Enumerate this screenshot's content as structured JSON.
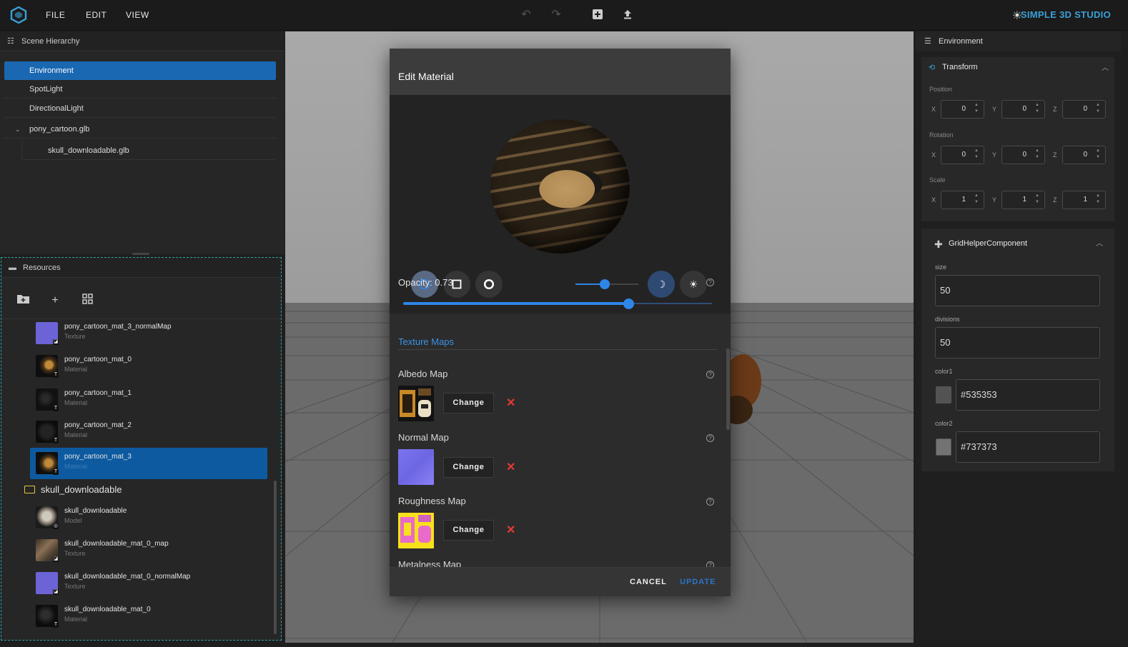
{
  "topbar": {
    "menu": [
      "FILE",
      "EDIT",
      "VIEW"
    ],
    "brand": "SIMPLE 3D STUDIO"
  },
  "scene": {
    "title": "Scene Hierarchy",
    "items": [
      "Environment",
      "SpotLight",
      "DirectionalLight",
      "pony_cartoon.glb",
      "skull_downloadable.glb"
    ]
  },
  "resources": {
    "title": "Resources",
    "items": [
      {
        "name": "pony_cartoon_mat_3_normalMap",
        "type": "Texture"
      },
      {
        "name": "pony_cartoon_mat_0",
        "type": "Material"
      },
      {
        "name": "pony_cartoon_mat_1",
        "type": "Material"
      },
      {
        "name": "pony_cartoon_mat_2",
        "type": "Material"
      },
      {
        "name": "pony_cartoon_mat_3",
        "type": "Material"
      }
    ],
    "folder": "skull_downloadable",
    "folder_items": [
      {
        "name": "skull_downloadable",
        "type": "Model"
      },
      {
        "name": "skull_downloadable_mat_0_map",
        "type": "Texture"
      },
      {
        "name": "skull_downloadable_mat_0_normalMap",
        "type": "Texture"
      },
      {
        "name": "skull_downloadable_mat_0",
        "type": "Material"
      }
    ]
  },
  "dialog": {
    "title": "Edit Material",
    "light_level": 0.47,
    "opacity_label": "Opacity: 0.73",
    "opacity": 0.73,
    "texture_maps_title": "Texture Maps",
    "maps": [
      {
        "label": "Albedo Map",
        "button": "Change"
      },
      {
        "label": "Normal Map",
        "button": "Change"
      },
      {
        "label": "Roughness Map",
        "button": "Change"
      },
      {
        "label": "Metalness Map"
      }
    ],
    "cancel": "CANCEL",
    "update": "UPDATE"
  },
  "inspector": {
    "title": "Environment",
    "transform": {
      "title": "Transform",
      "position_label": "Position",
      "rotation_label": "Rotation",
      "scale_label": "Scale",
      "axes": [
        "X",
        "Y",
        "Z"
      ],
      "position": [
        "0",
        "0",
        "0"
      ],
      "rotation": [
        "0",
        "0",
        "0"
      ],
      "scale": [
        "1",
        "1",
        "1"
      ]
    },
    "grid": {
      "title": "GridHelperComponent",
      "size_label": "size",
      "size": "50",
      "divisions_label": "divisions",
      "divisions": "50",
      "color1_label": "color1",
      "color1": "#535353",
      "color2_label": "color2",
      "color2": "#737373"
    }
  },
  "colors": {
    "accent": "#2d86e8",
    "selected": "#1a68b2",
    "brand": "#3aa0d8",
    "danger": "#e53935"
  }
}
